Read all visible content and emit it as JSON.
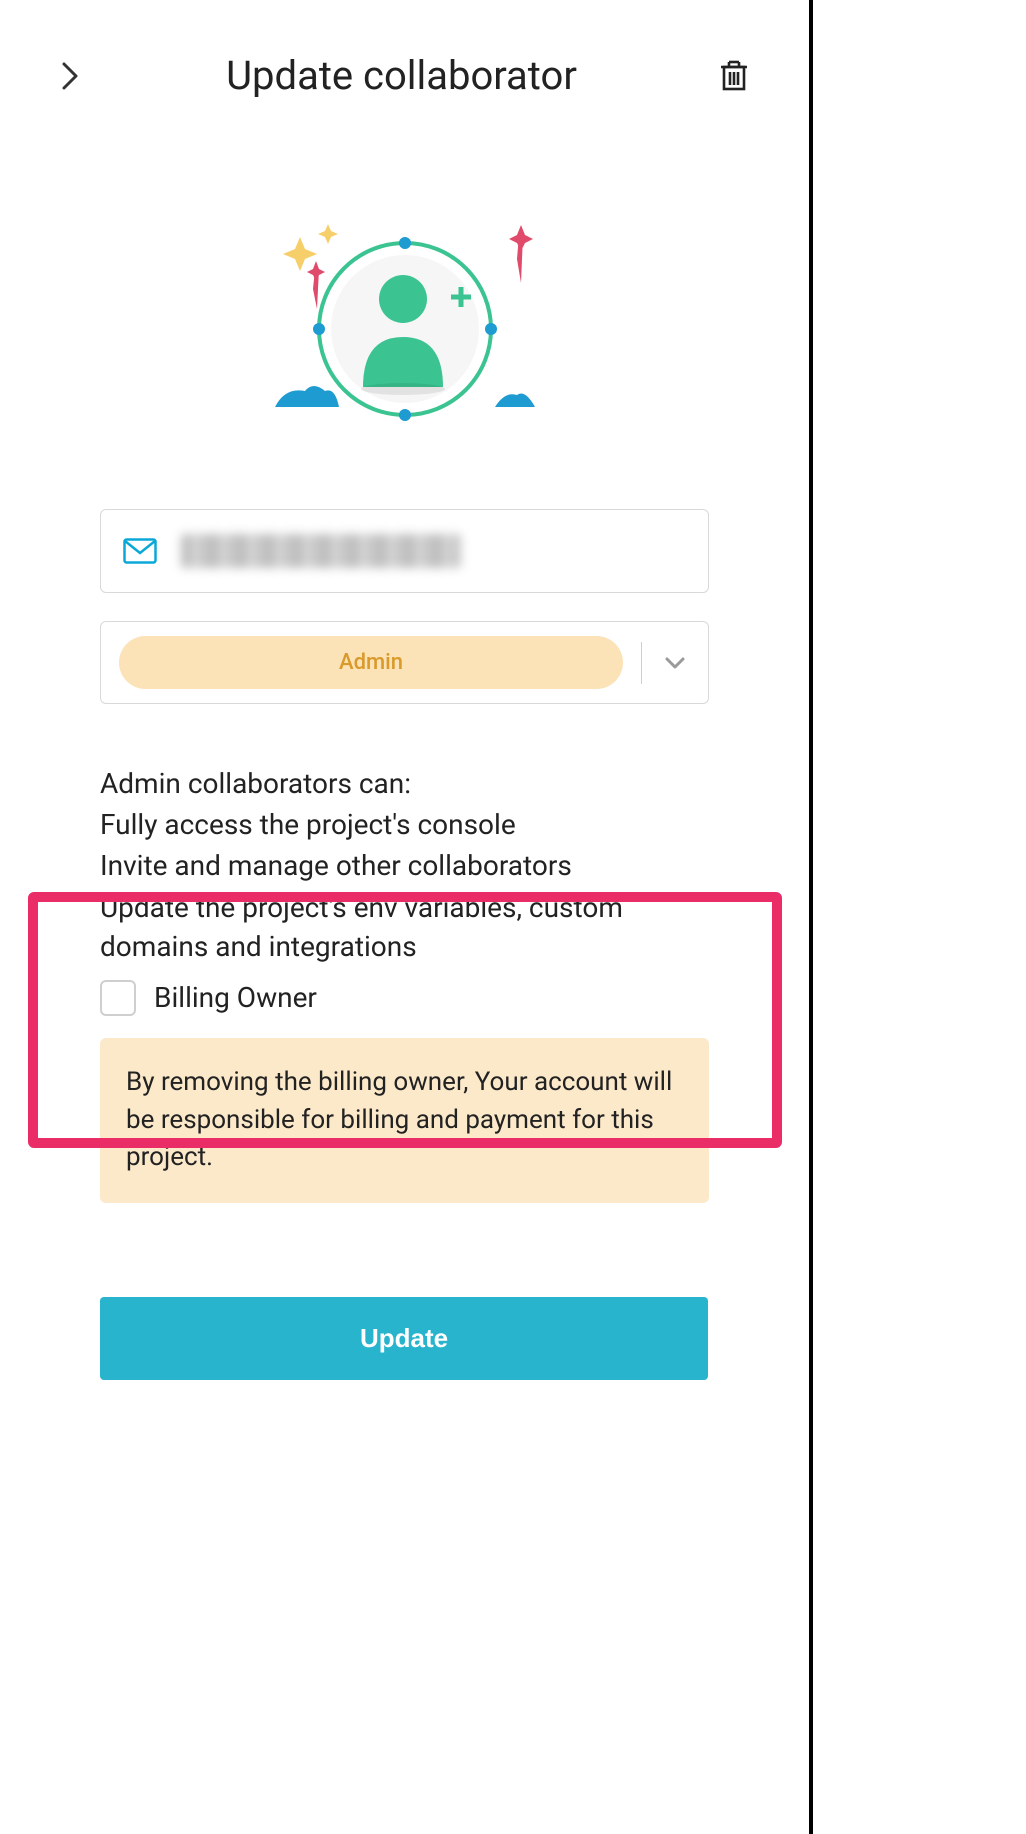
{
  "header": {
    "title": "Update collaborator"
  },
  "email": {
    "value": "(redacted)"
  },
  "role": {
    "selected": "Admin"
  },
  "description": {
    "heading": "Admin collaborators can:",
    "line1": "Fully access the project's console",
    "line2": "Invite and manage other collaborators",
    "line3": "Update the project's env variables, custom domains and integrations"
  },
  "billing": {
    "label": "Billing Owner",
    "warning": "By removing the billing owner, Your account will be responsible for billing and payment for this project."
  },
  "actions": {
    "update": "Update"
  }
}
